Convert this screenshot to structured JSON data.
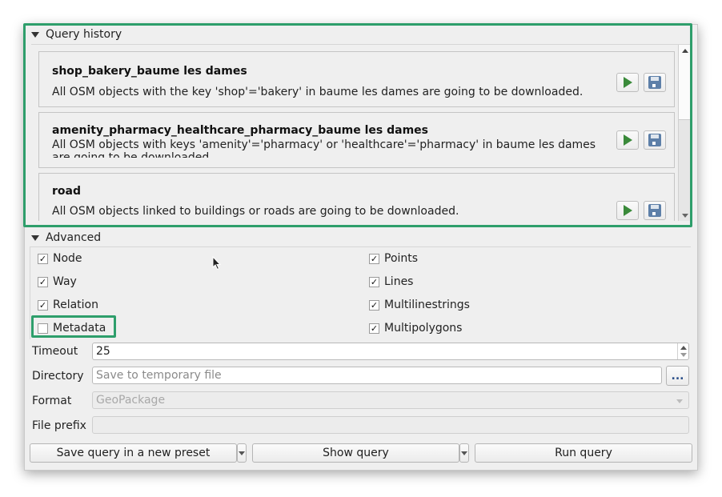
{
  "query_history": {
    "title": "Query history",
    "items": [
      {
        "title": "shop_bakery_baume les dames",
        "description": "All OSM objects with the key 'shop'='bakery' in baume les dames are going to be downloaded."
      },
      {
        "title": "amenity_pharmacy_healthcare_pharmacy_baume les dames",
        "description": "All OSM objects with keys 'amenity'='pharmacy' or 'healthcare'='pharmacy' in baume les dames are going to be downloaded."
      },
      {
        "title": "road",
        "description": "All OSM objects linked to buildings or roads are going to be downloaded."
      }
    ],
    "scroll_position_fraction": 0.0
  },
  "advanced": {
    "title": "Advanced",
    "osm_types": [
      {
        "label": "Node",
        "checked": true
      },
      {
        "label": "Way",
        "checked": true
      },
      {
        "label": "Relation",
        "checked": true
      },
      {
        "label": "Metadata",
        "checked": false
      }
    ],
    "geometry_types": [
      {
        "label": "Points",
        "checked": true
      },
      {
        "label": "Lines",
        "checked": true
      },
      {
        "label": "Multilinestrings",
        "checked": true
      },
      {
        "label": "Multipolygons",
        "checked": true
      }
    ],
    "timeout": {
      "label": "Timeout",
      "value": "25"
    },
    "directory": {
      "label": "Directory",
      "placeholder": "Save to temporary file",
      "browse_label": "..."
    },
    "format": {
      "label": "Format",
      "value": "GeoPackage"
    },
    "file_prefix": {
      "label": "File prefix",
      "value": ""
    }
  },
  "buttons": {
    "save_preset": "Save query in a new preset",
    "show_query": "Show query",
    "run_query": "Run query"
  },
  "check_glyph": "✓",
  "highlight_color": "#2e9e6b"
}
